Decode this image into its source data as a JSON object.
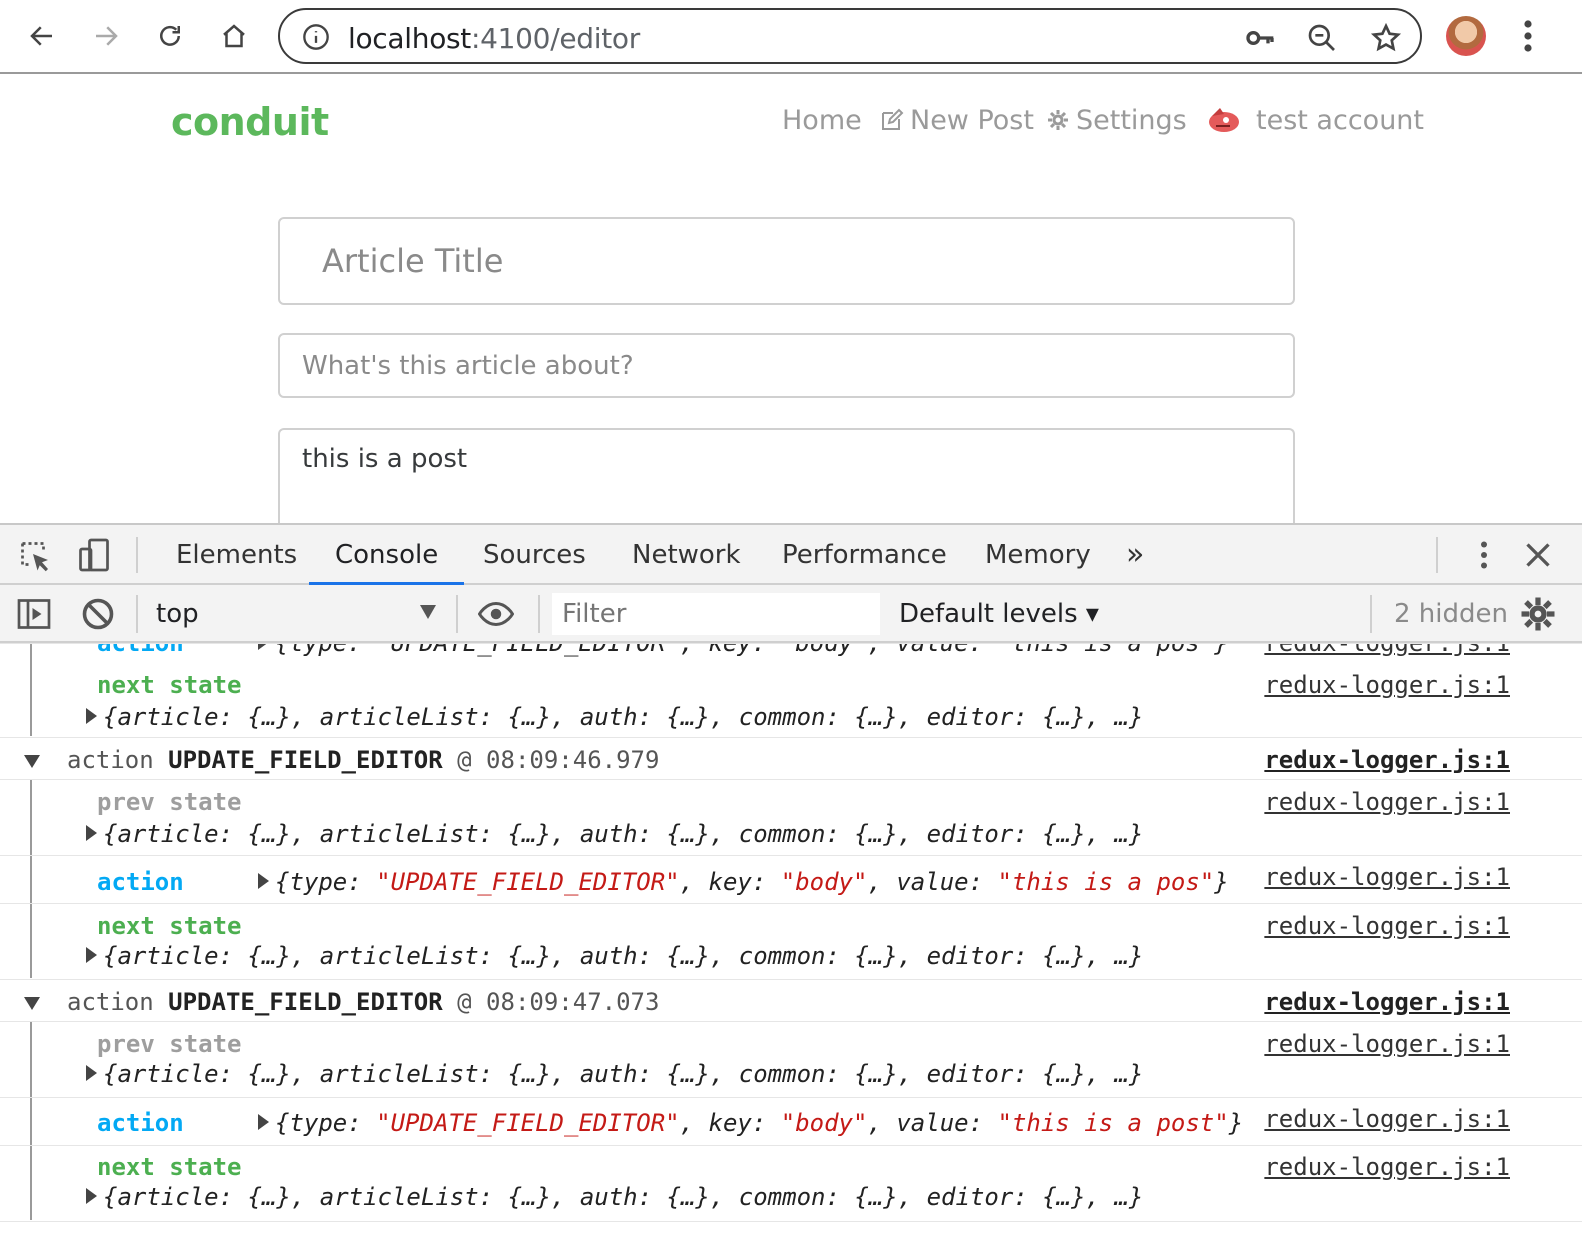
{
  "browser": {
    "url_host": "localhost",
    "url_path": ":4100/editor"
  },
  "site": {
    "brand": "conduit",
    "nav": {
      "home": "Home",
      "new_post": "New Post",
      "settings": "Settings",
      "user": "test account"
    }
  },
  "editor": {
    "title_placeholder": "Article Title",
    "description_placeholder": "What's this article about?",
    "body_value": "this is a post"
  },
  "devtools": {
    "tabs": [
      "Elements",
      "Console",
      "Sources",
      "Network",
      "Performance",
      "Memory"
    ],
    "more": "»",
    "context": "top",
    "filter_placeholder": "Filter",
    "levels": "Default levels",
    "hidden": "2 hidden"
  },
  "console": {
    "source": "redux-logger.js:1",
    "labels": {
      "prev": "prev state",
      "next": "next state",
      "action": "action"
    },
    "state_obj": "{article: {…}, articleList: {…}, auth: {…}, common: {…}, editor: {…}, …}",
    "partial_action": "{type: \"UPDATE_FIELD_EDITOR\", key: \"body\", value: \"this is a pos\"}",
    "groups": [
      {
        "prefix": "action ",
        "type": "UPDATE_FIELD_EDITOR",
        "time": " @ 08:09:46.979",
        "action_type": "\"UPDATE_FIELD_EDITOR\"",
        "action_key": "\"body\"",
        "action_value": "\"this is a pos\""
      },
      {
        "prefix": "action ",
        "type": "UPDATE_FIELD_EDITOR",
        "time": " @ 08:09:47.073",
        "action_type": "\"UPDATE_FIELD_EDITOR\"",
        "action_key": "\"body\"",
        "action_value": "\"this is a post\""
      }
    ]
  }
}
